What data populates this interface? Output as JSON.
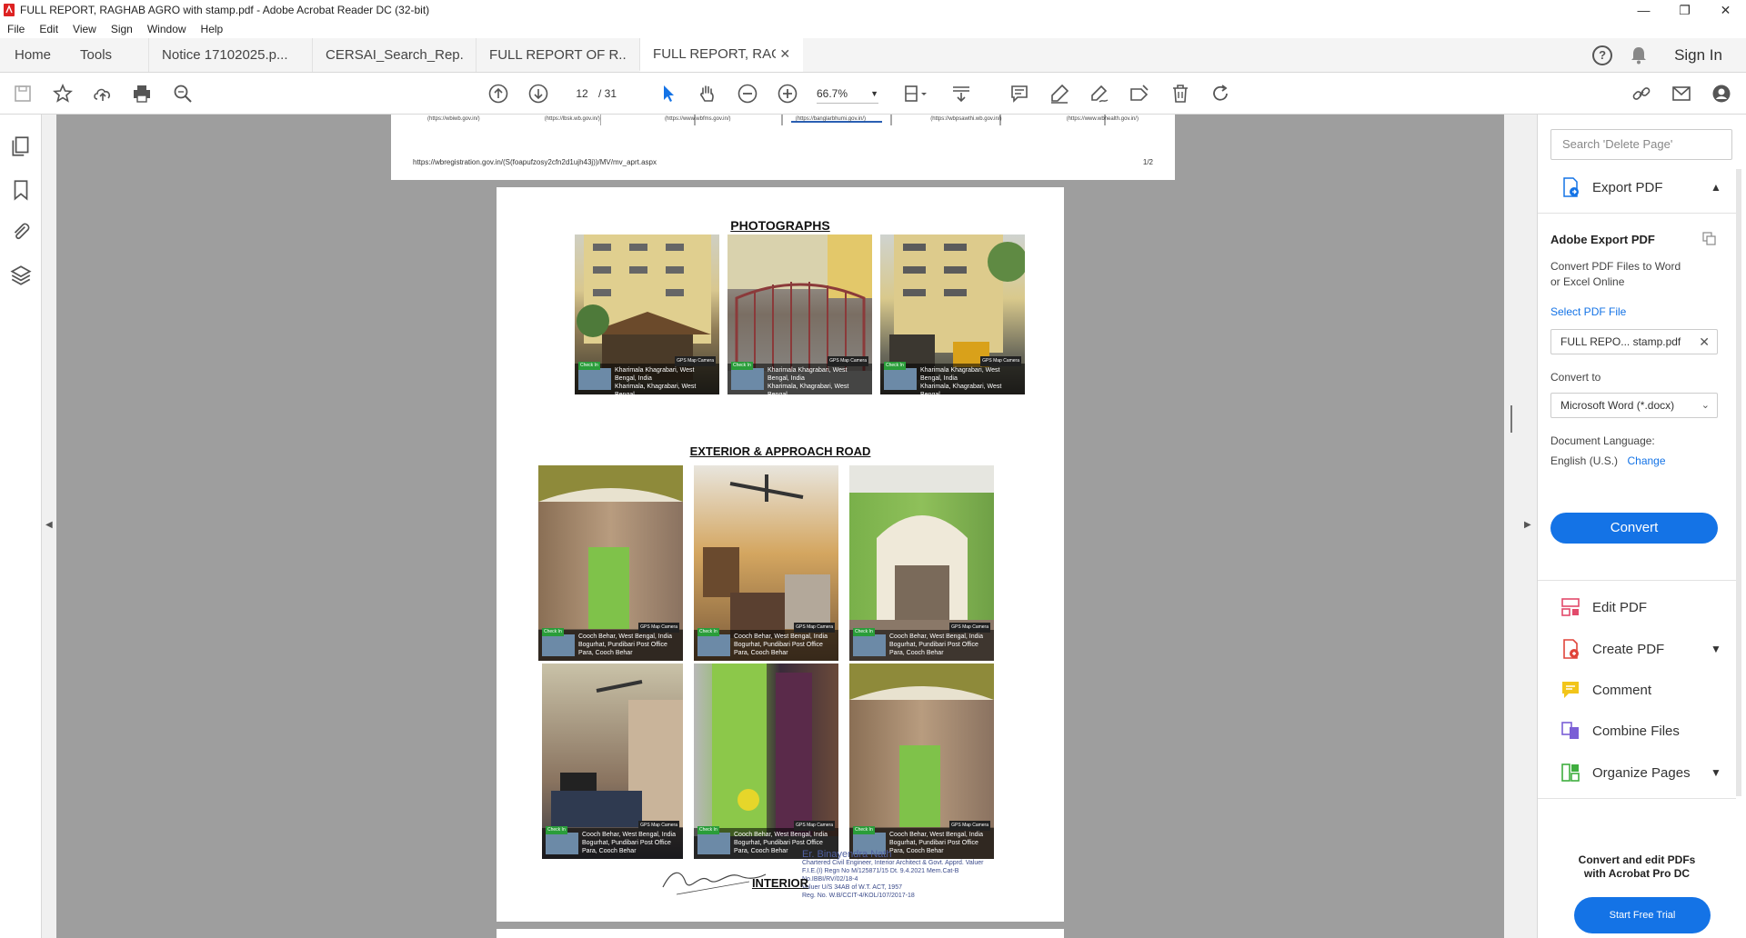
{
  "window": {
    "title": "FULL REPORT, RAGHAB AGRO with stamp.pdf - Adobe Acrobat Reader DC (32-bit)",
    "controls": [
      "—",
      "❐",
      "✕"
    ]
  },
  "menu": [
    "File",
    "Edit",
    "View",
    "Sign",
    "Window",
    "Help"
  ],
  "tabs": {
    "home": "Home",
    "tools": "Tools",
    "documents": [
      {
        "label": "Notice 17102025.p..."
      },
      {
        "label": "CERSAI_Search_Rep..."
      },
      {
        "label": "FULL REPORT OF R..."
      },
      {
        "label": "FULL REPORT, RAG...",
        "active": true,
        "close": "✕"
      }
    ],
    "help": "?",
    "sign_in": "Sign In"
  },
  "toolbar": {
    "page_current": "12",
    "page_total": "/ 31",
    "zoom": "66.7%"
  },
  "document": {
    "prev_page": {
      "urls": [
        "(https://wbiwb.gov.in/)",
        "(https://lbsk.wb.gov.in/)",
        "(https://www.wbfms.gov.in/)",
        "(https://banglarbhumi.gov.in/)",
        "(https://wbpsawthi.wb.gov.in/)",
        "(https://www.wbhealth.gov.in/)"
      ],
      "footer_url": "https://wbregistration.gov.in/(S(foapufzosy2cfn2d1ujh43j))/MV/mv_aprt.aspx",
      "page_num": "1/2"
    },
    "page": {
      "heading1": "PHOTOGRAPHS",
      "heading2": "EXTERIOR & APPROACH ROAD",
      "heading3": "INTERIOR",
      "exterior_photos": [
        {
          "caption": "Kharimala Khagrabari, West Bengal, India",
          "sub": "Kharimala, Khagrabari, West Bengal"
        },
        {
          "caption": "Kharimala Khagrabari, West Bengal, India",
          "sub": "Kharimala, Khagrabari, West Bengal"
        },
        {
          "caption": "Kharimala Khagrabari, West Bengal, India",
          "sub": "Kharimala, Khagrabari, West Bengal"
        }
      ],
      "interior_photos": [
        {
          "caption": "Cooch Behar, West Bengal, India",
          "sub": "Bogurhat, Pundibari Post Office Para, Cooch Behar"
        },
        {
          "caption": "Cooch Behar, West Bengal, India",
          "sub": "Bogurhat, Pundibari Post Office Para, Cooch Behar"
        },
        {
          "caption": "Cooch Behar, West Bengal, India",
          "sub": "Bogurhat, Pundibari Post Office Para, Cooch Behar"
        },
        {
          "caption": "Cooch Behar, West Bengal, India",
          "sub": "Bogurhat, Pundibari Post Office Para, Cooch Behar"
        },
        {
          "caption": "Cooch Behar, West Bengal, India",
          "sub": "Bogurhat, Pundibari Post Office Para, Cooch Behar"
        },
        {
          "caption": "Cooch Behar, West Bengal, India",
          "sub": "Bogurhat, Pundibari Post Office Para, Cooch Behar"
        }
      ],
      "photo_tag": "Check In",
      "gps_tag": "GPS Map Camera",
      "stamp": {
        "name": "Er. Binayendra Nath",
        "line1": "Chartered Civil Engineer, Interior Architect & Govt. Apprd. Valuer",
        "line2": "F.I.E.(I) Regn No M/125871/15 Dt. 9.4.2021 Mem.Cat-B No.IBBI/RV/02/18-4",
        "line3": "Valuer U/S 34AB of W.T. ACT, 1957",
        "line4": "Reg. No. W.B/CCIT-4/KOL/107/2017-18"
      }
    }
  },
  "right_panel": {
    "search_placeholder": "Search 'Delete Page'",
    "export_pdf": "Export PDF",
    "adobe_export_title": "Adobe Export PDF",
    "adobe_export_desc1": "Convert PDF Files to Word",
    "adobe_export_desc2": "or Excel Online",
    "select_pdf_file": "Select PDF File",
    "selected_file": "FULL REPO... stamp.pdf",
    "convert_to_label": "Convert to",
    "convert_to_value": "Microsoft Word (*.docx)",
    "doc_language_label": "Document Language:",
    "doc_language_value": "English (U.S.)",
    "change": "Change",
    "convert": "Convert",
    "tools": [
      "Edit PDF",
      "Create PDF",
      "Comment",
      "Combine Files",
      "Organize Pages"
    ],
    "promo_line1": "Convert and edit PDFs",
    "promo_line2": "with Acrobat Pro DC",
    "start_trial": "Start Free Trial"
  },
  "colors": {
    "accent": "#1473e6",
    "doc_background": "#9e9e9e",
    "edit_pdf_icon": "#e24a6b",
    "create_pdf_icon": "#e0443a",
    "comment_icon": "#f2c51a",
    "combine_icon": "#7b5fd6",
    "organize_icon": "#3fae3f"
  }
}
